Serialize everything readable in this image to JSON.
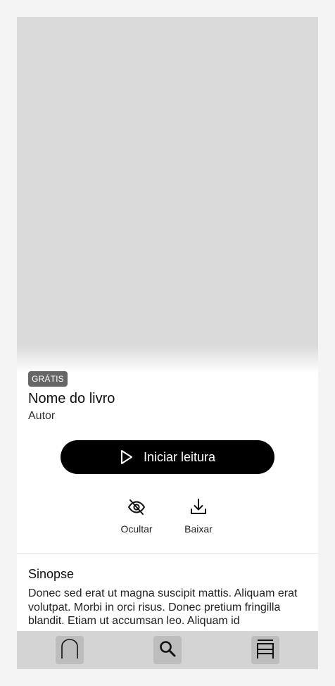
{
  "book": {
    "badge": "GRÁTIS",
    "title": "Nome do livro",
    "author": "Autor"
  },
  "actions": {
    "read_label": "Iniciar leitura",
    "hide_label": "Ocultar",
    "download_label": "Baixar"
  },
  "synopsis": {
    "heading": "Sinopse",
    "text": "Donec sed erat ut magna suscipit mattis. Aliquam erat volutpat. Morbi in orci risus. Donec pretium fringilla blandit. Etiam ut accumsan leo. Aliquam id"
  },
  "nav": {
    "tabs": [
      {
        "icon": "home-icon"
      },
      {
        "icon": "search-icon"
      },
      {
        "icon": "library-icon"
      }
    ]
  },
  "colors": {
    "primary_button": "#000000",
    "badge_bg": "#666666",
    "cover_placeholder": "#dadada",
    "tabbar_bg": "#d4d4d4",
    "tab_button_bg": "#bdbdbd"
  }
}
